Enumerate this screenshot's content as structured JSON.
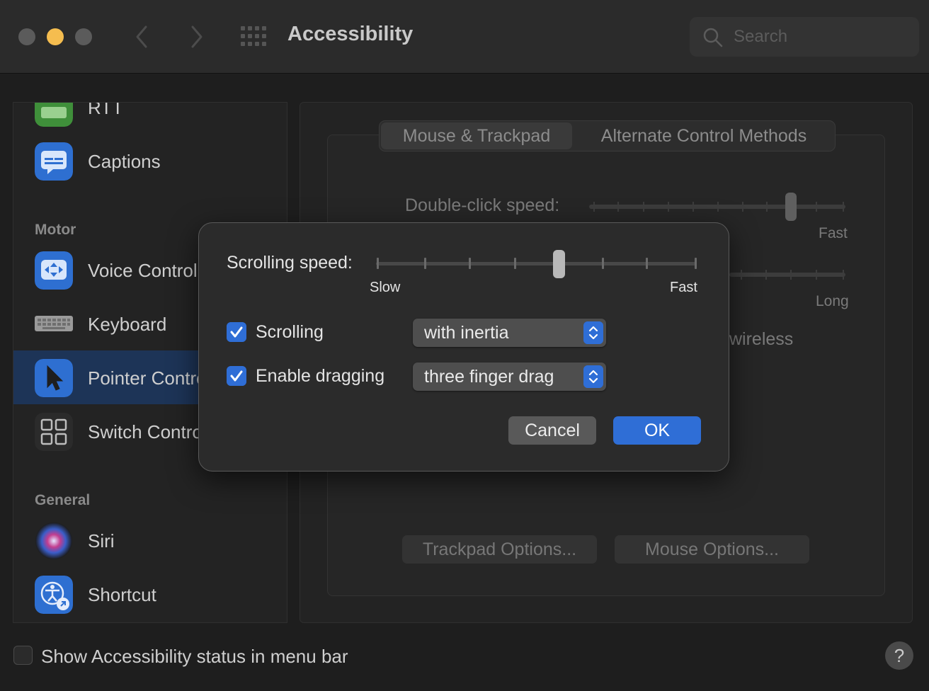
{
  "window": {
    "title": "Accessibility",
    "search_placeholder": "Search"
  },
  "sidebar": {
    "items": [
      {
        "label": "RTT",
        "icon": "keyboard-rtt-icon",
        "color": "#3f8f3a"
      },
      {
        "label": "Captions",
        "icon": "captions-icon",
        "color": "#2e6fd1"
      },
      {
        "label": "Voice Control",
        "icon": "voice-control-icon",
        "color": "#2e6fd1"
      },
      {
        "label": "Keyboard",
        "icon": "keyboard-icon",
        "color": "#8a8a8a"
      },
      {
        "label": "Pointer Control",
        "icon": "pointer-icon",
        "color": "#2e6fd1"
      },
      {
        "label": "Switch Control",
        "icon": "switch-control-icon",
        "color": "#2e2e2e"
      },
      {
        "label": "Siri",
        "icon": "siri-icon",
        "color": "#333"
      },
      {
        "label": "Shortcut",
        "icon": "accessibility-shortcut-icon",
        "color": "#2e6fd1"
      }
    ],
    "sections": {
      "motor": "Motor",
      "general": "General"
    },
    "selected": "Pointer Control"
  },
  "main": {
    "tabs": [
      {
        "label": "Mouse & Trackpad",
        "selected": true
      },
      {
        "label": "Alternate Control Methods",
        "selected": false
      }
    ],
    "double_click_label": "Double-click speed:",
    "fast_label": "Fast",
    "long_label": "Long",
    "wireless_label": "wireless",
    "trackpad_options": "Trackpad Options...",
    "mouse_options": "Mouse Options..."
  },
  "dialog": {
    "scrolling_speed_label": "Scrolling speed:",
    "slow_label": "Slow",
    "fast_label": "Fast",
    "scrolling_speed_value": 0.55,
    "scrolling": {
      "label": "Scrolling",
      "checked": true,
      "value": "with inertia"
    },
    "dragging": {
      "label": "Enable dragging",
      "checked": true,
      "value": "three finger drag"
    },
    "cancel_label": "Cancel",
    "ok_label": "OK"
  },
  "footer": {
    "status_label": "Show Accessibility status in menu bar",
    "status_checked": false,
    "help_label": "?"
  },
  "colors": {
    "accent": "#2f6ed6",
    "selected_row": "#1d3457"
  }
}
